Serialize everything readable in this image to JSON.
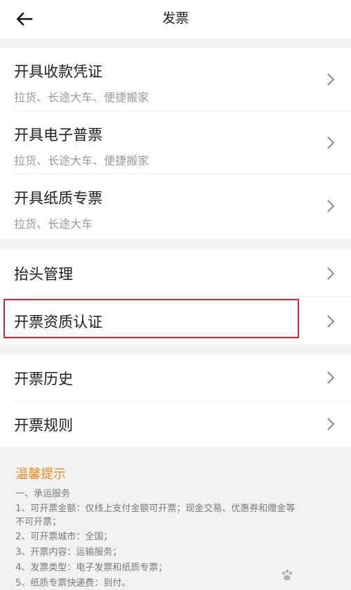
{
  "header": {
    "title": "发票",
    "back_icon": "arrow-left-icon"
  },
  "section1": [
    {
      "title": "开具收款凭证",
      "subtitle": "拉货、长途大车、便捷搬家"
    },
    {
      "title": "开具电子普票",
      "subtitle": "拉货、长途大车、便捷搬家"
    },
    {
      "title": "开具纸质专票",
      "subtitle": "拉货、长途大车"
    }
  ],
  "section2": [
    {
      "title": "抬头管理"
    },
    {
      "title": "开票资质认证"
    }
  ],
  "section3": [
    {
      "title": "开票历史"
    },
    {
      "title": "开票规则"
    }
  ],
  "tips": {
    "title": "温馨提示",
    "lines": [
      "一、承运服务",
      "1、可开票金额：仅线上支付金额可开票；现金交易、优惠券和赠金等",
      "不可开票；",
      "2、可开票城市：全国；",
      "3、开票内容：运输服务；",
      "4、发票类型：电子发票和纸质专票；",
      "5、纸质专票快递费：到付。"
    ]
  },
  "colors": {
    "accent_orange": "#f08a1c",
    "highlight_red": "#d8262e"
  }
}
